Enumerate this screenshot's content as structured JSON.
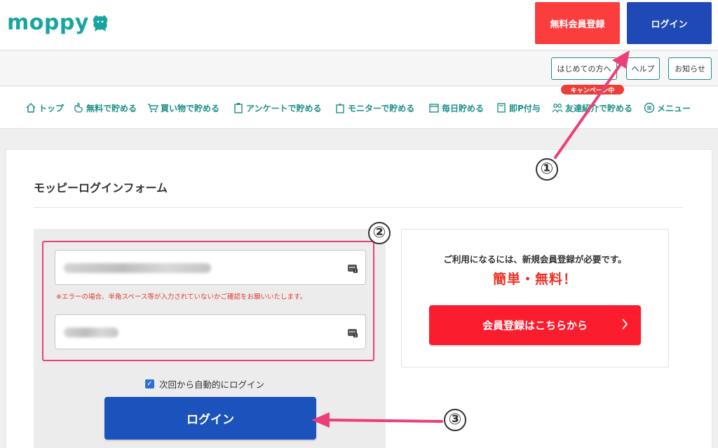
{
  "header": {
    "logo_text": "moppy",
    "register_button": "無料会員登録",
    "login_button": "ログイン"
  },
  "subnav": {
    "guide": "はじめての方へ",
    "help": "ヘルプ",
    "news": "お知らせ"
  },
  "nav": {
    "items": [
      {
        "label": "トップ",
        "icon": "home-icon"
      },
      {
        "label": "無料で貯める",
        "icon": "hand-icon"
      },
      {
        "label": "買い物で貯める",
        "icon": "cart-icon"
      },
      {
        "label": "アンケートで貯める",
        "icon": "clipboard-icon"
      },
      {
        "label": "モニターで貯める",
        "icon": "bag-icon"
      },
      {
        "label": "毎日貯める",
        "icon": "calendar-icon"
      },
      {
        "label": "即P付与",
        "icon": "book-icon"
      },
      {
        "label": "友達紹介で貯める",
        "icon": "friends-icon"
      },
      {
        "label": "メニュー",
        "icon": "menu-icon"
      }
    ],
    "campaign_badge": "キャンペーン中"
  },
  "form": {
    "title": "モッピーログインフォーム",
    "error_note": "※エラーの場合、半角スペース等が入力されていないかご確認をお願いいたします。",
    "remember_label": "次回から自動的にログイン",
    "remember_checked": true,
    "login_button": "ログイン"
  },
  "register_panel": {
    "notice": "ご利用になるには、新規会員登録が必要です。",
    "highlight": "簡単・無料！",
    "button": "会員登録はこちらから"
  },
  "annotations": {
    "step1": "①",
    "step2": "②",
    "step3": "③",
    "color": "#ea3f78"
  },
  "colors": {
    "brand": "#17a5a0",
    "register_red": "#fb3d3d",
    "login_blue": "#1f49b6"
  }
}
